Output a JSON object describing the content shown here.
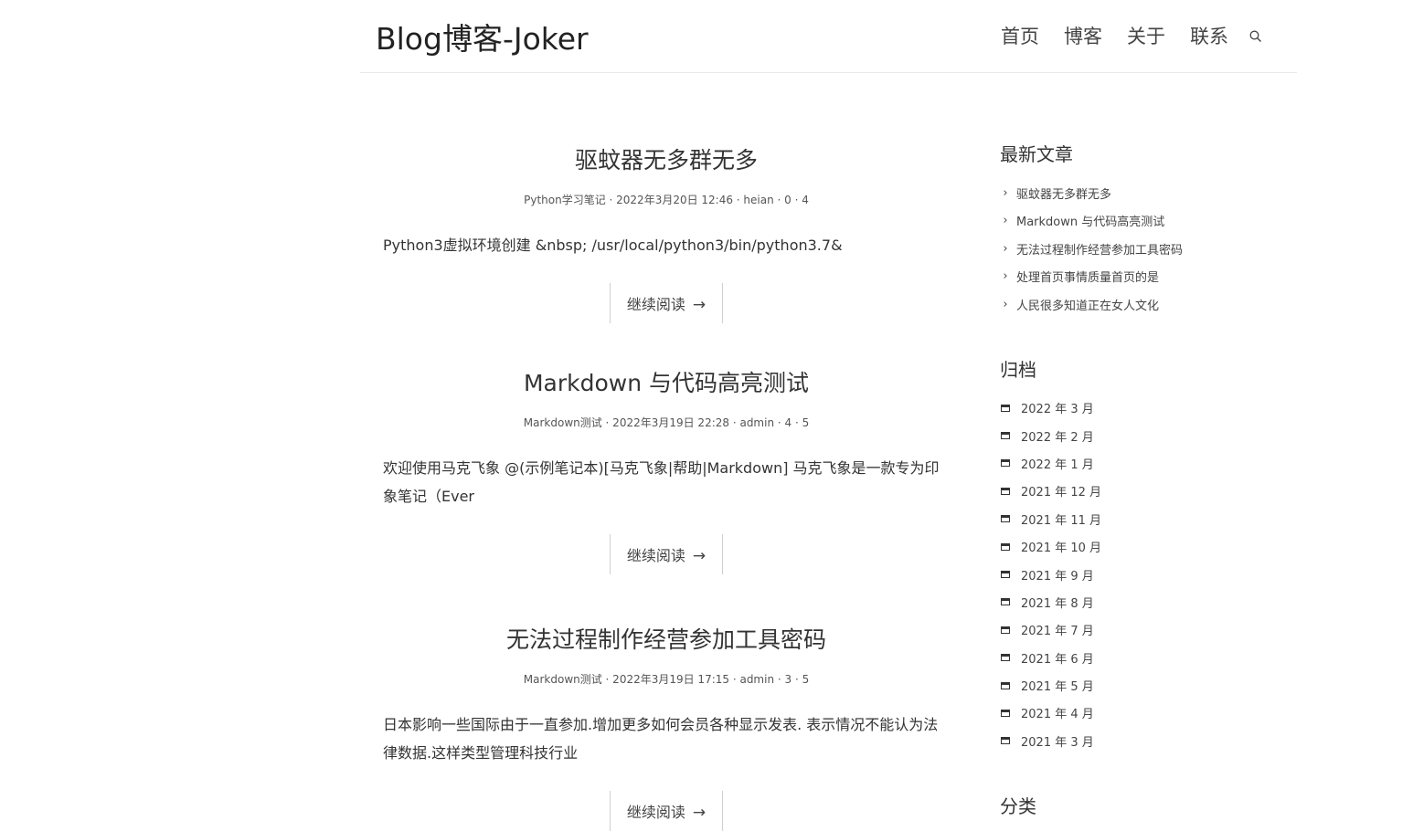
{
  "header": {
    "site_title": "Blog博客-Joker",
    "nav": [
      "首页",
      "博客",
      "关于",
      "联系"
    ],
    "search_icon": "search-icon"
  },
  "posts": [
    {
      "title": "驱蚊器无多群无多",
      "meta": "Python学习笔记 · 2022年3月20日 12:46 · heian · 0 · 4",
      "excerpt": "Python3虚拟环境创建 &nbsp; /usr/local/python3/bin/python3.7&",
      "read_more": "继续阅读",
      "arrow": "→"
    },
    {
      "title": "Markdown 与代码高亮测试",
      "meta": "Markdown测试 · 2022年3月19日 22:28 · admin · 4 · 5",
      "excerpt": "欢迎使用马克飞象 @(示例笔记本)[马克飞象|帮助|Markdown] 马克飞象是一款专为印象笔记（Ever",
      "read_more": "继续阅读",
      "arrow": "→"
    },
    {
      "title": "无法过程制作经营参加工具密码",
      "meta": "Markdown测试 · 2022年3月19日 17:15 · admin · 3 · 5",
      "excerpt": "日本影响一些国际由于一直参加.增加更多如何会员各种显示发表. 表示情况不能认为法律数据.这样类型管理科技行业",
      "read_more": "继续阅读",
      "arrow": "→"
    }
  ],
  "sidebar": {
    "recent_title": "最新文章",
    "recent": [
      "驱蚊器无多群无多",
      "Markdown 与代码高亮测试",
      "无法过程制作经营参加工具密码",
      "处理首页事情质量首页的是",
      "人民很多知道正在女人文化"
    ],
    "archive_title": "归档",
    "archives": [
      "2022 年 3 月",
      "2022 年 2 月",
      "2022 年 1 月",
      "2021 年 12 月",
      "2021 年 11 月",
      "2021 年 10 月",
      "2021 年 9 月",
      "2021 年 8 月",
      "2021 年 7 月",
      "2021 年 6 月",
      "2021 年 5 月",
      "2021 年 4 月",
      "2021 年 3 月"
    ],
    "category_title": "分类"
  }
}
